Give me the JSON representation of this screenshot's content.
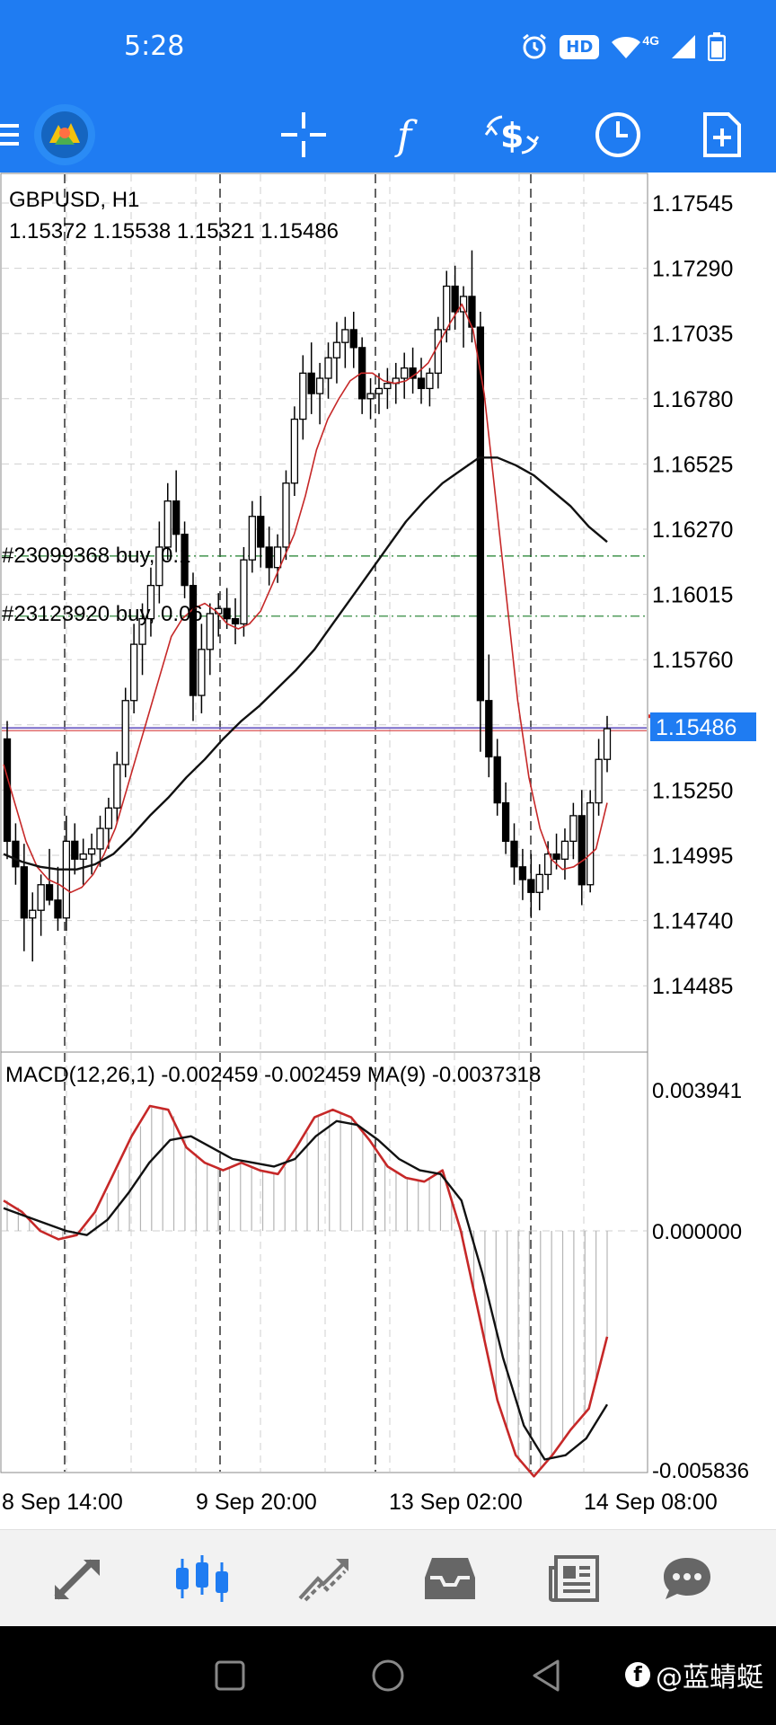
{
  "status_bar": {
    "time": "5:28",
    "hd_label": "HD",
    "network_label": "4G",
    "icons": [
      "alarm-icon",
      "wifi-icon",
      "signal-icon",
      "battery-icon"
    ]
  },
  "toolbar": {
    "buttons": [
      "menu-icon",
      "app-logo",
      "crosshair-icon",
      "function-icon",
      "currency-icon",
      "clock-icon",
      "new-document-icon"
    ]
  },
  "chart": {
    "symbol_label": "GBPUSD, H1",
    "ohlc_label": "1.15372 1.15538 1.15321 1.15486",
    "current_price": "1.15486",
    "price_color": "#1f7cf2",
    "bid_line_color": "#d32f2f",
    "ma_fast_color": "#c62828",
    "ma_slow_color": "#111111",
    "order_lines": [
      {
        "label": "#23099368 buy, 0.1",
        "price": 1.16165
      },
      {
        "label": "#23123920 buy, 0.06",
        "price": 1.1593
      }
    ],
    "price_axis": [
      "1.17545",
      "1.17290",
      "1.17035",
      "1.16780",
      "1.16525",
      "1.16270",
      "1.16015",
      "1.15760",
      "1.15250",
      "1.14995",
      "1.14740",
      "1.14485"
    ],
    "macd_label": "MACD(12,26,1) -0.002459 -0.002459 MA(9) -0.0037318",
    "macd_axis": [
      "0.003941",
      "0.000000",
      "-0.005836"
    ],
    "time_axis": [
      "8 Sep 14:00",
      "9 Sep 20:00",
      "13 Sep 02:00",
      "14 Sep 08:00"
    ]
  },
  "chart_data": {
    "type": "candlestick",
    "title": "GBPUSD, H1",
    "ylim": [
      1.1436,
      1.1766
    ],
    "macd_ylim": [
      -0.005836,
      0.003941
    ],
    "candles": [
      [
        1.1545,
        1.1552,
        1.1498,
        1.1505
      ],
      [
        1.1505,
        1.1512,
        1.1488,
        1.1495
      ],
      [
        1.1495,
        1.1504,
        1.1462,
        1.1475
      ],
      [
        1.1475,
        1.1485,
        1.1458,
        1.1478
      ],
      [
        1.1478,
        1.1492,
        1.1468,
        1.1488
      ],
      [
        1.1488,
        1.1502,
        1.148,
        1.1482
      ],
      [
        1.1482,
        1.1495,
        1.147,
        1.1475
      ],
      [
        1.1475,
        1.1515,
        1.147,
        1.1505
      ],
      [
        1.1505,
        1.1512,
        1.1492,
        1.1498
      ],
      [
        1.1498,
        1.1506,
        1.1488,
        1.15
      ],
      [
        1.15,
        1.1508,
        1.1492,
        1.1502
      ],
      [
        1.1502,
        1.1515,
        1.1495,
        1.151
      ],
      [
        1.151,
        1.1522,
        1.1502,
        1.1518
      ],
      [
        1.1518,
        1.154,
        1.1512,
        1.1535
      ],
      [
        1.1535,
        1.1565,
        1.153,
        1.156
      ],
      [
        1.156,
        1.159,
        1.1555,
        1.1582
      ],
      [
        1.1582,
        1.1598,
        1.157,
        1.1592
      ],
      [
        1.1592,
        1.1612,
        1.1585,
        1.1605
      ],
      [
        1.1605,
        1.163,
        1.1598,
        1.162
      ],
      [
        1.162,
        1.1645,
        1.1615,
        1.1638
      ],
      [
        1.1638,
        1.165,
        1.1618,
        1.1625
      ],
      [
        1.1625,
        1.163,
        1.16,
        1.1605
      ],
      [
        1.1605,
        1.161,
        1.1552,
        1.1562
      ],
      [
        1.1562,
        1.159,
        1.1555,
        1.158
      ],
      [
        1.158,
        1.1598,
        1.157,
        1.1594
      ],
      [
        1.1594,
        1.1602,
        1.1585,
        1.1596
      ],
      [
        1.1596,
        1.1604,
        1.1588,
        1.1592
      ],
      [
        1.1592,
        1.16,
        1.1582,
        1.159
      ],
      [
        1.159,
        1.162,
        1.1585,
        1.1615
      ],
      [
        1.1615,
        1.1638,
        1.161,
        1.1632
      ],
      [
        1.1632,
        1.164,
        1.1612,
        1.162
      ],
      [
        1.162,
        1.1628,
        1.1605,
        1.1612
      ],
      [
        1.1612,
        1.1625,
        1.1606,
        1.162
      ],
      [
        1.162,
        1.165,
        1.1615,
        1.1645
      ],
      [
        1.1645,
        1.1675,
        1.164,
        1.167
      ],
      [
        1.167,
        1.1695,
        1.1662,
        1.1688
      ],
      [
        1.1688,
        1.17,
        1.1672,
        1.168
      ],
      [
        1.168,
        1.1692,
        1.1668,
        1.1686
      ],
      [
        1.1686,
        1.17,
        1.1678,
        1.1694
      ],
      [
        1.1694,
        1.1708,
        1.1684,
        1.17
      ],
      [
        1.17,
        1.171,
        1.169,
        1.1705
      ],
      [
        1.1705,
        1.1712,
        1.169,
        1.1698
      ],
      [
        1.1698,
        1.1702,
        1.1672,
        1.1678
      ],
      [
        1.1678,
        1.1686,
        1.167,
        1.168
      ],
      [
        1.168,
        1.1688,
        1.1672,
        1.1682
      ],
      [
        1.1682,
        1.169,
        1.1674,
        1.1684
      ],
      [
        1.1684,
        1.1692,
        1.1676,
        1.1686
      ],
      [
        1.1686,
        1.1696,
        1.1678,
        1.169
      ],
      [
        1.169,
        1.1698,
        1.168,
        1.1686
      ],
      [
        1.1686,
        1.1694,
        1.1676,
        1.1682
      ],
      [
        1.1682,
        1.169,
        1.1675,
        1.1688
      ],
      [
        1.1688,
        1.171,
        1.1682,
        1.1705
      ],
      [
        1.1705,
        1.1728,
        1.17,
        1.1722
      ],
      [
        1.1722,
        1.173,
        1.1705,
        1.1712
      ],
      [
        1.1712,
        1.1722,
        1.1698,
        1.1718
      ],
      [
        1.1718,
        1.1736,
        1.17,
        1.1706
      ],
      [
        1.1706,
        1.1712,
        1.154,
        1.156
      ],
      [
        1.156,
        1.1578,
        1.153,
        1.1538
      ],
      [
        1.1538,
        1.1545,
        1.1515,
        1.152
      ],
      [
        1.152,
        1.1528,
        1.15,
        1.1505
      ],
      [
        1.1505,
        1.1512,
        1.1488,
        1.1495
      ],
      [
        1.1495,
        1.1502,
        1.1482,
        1.149
      ],
      [
        1.149,
        1.15,
        1.1475,
        1.1485
      ],
      [
        1.1485,
        1.1496,
        1.1478,
        1.1492
      ],
      [
        1.1492,
        1.1505,
        1.1486,
        1.15
      ],
      [
        1.15,
        1.1508,
        1.1494,
        1.1498
      ],
      [
        1.1498,
        1.151,
        1.149,
        1.1505
      ],
      [
        1.1505,
        1.152,
        1.1498,
        1.1515
      ],
      [
        1.1515,
        1.1525,
        1.148,
        1.1488
      ],
      [
        1.1488,
        1.1525,
        1.1485,
        1.152
      ],
      [
        1.152,
        1.1545,
        1.1515,
        1.1537
      ],
      [
        1.1537,
        1.1554,
        1.1532,
        1.1549
      ]
    ],
    "ma_fast": [
      1.1535,
      1.152,
      1.1505,
      1.1495,
      1.149,
      1.1488,
      1.1485,
      1.1487,
      1.1492,
      1.15,
      1.151,
      1.1525,
      1.154,
      1.1555,
      1.157,
      1.1585,
      1.1592,
      1.1596,
      1.1598,
      1.1595,
      1.159,
      1.1588,
      1.159,
      1.1595,
      1.1605,
      1.1615,
      1.1625,
      1.164,
      1.1658,
      1.167,
      1.1678,
      1.1685,
      1.1688,
      1.1688,
      1.1685,
      1.1684,
      1.1685,
      1.1688,
      1.1692,
      1.17,
      1.1708,
      1.1715,
      1.1705,
      1.168,
      1.164,
      1.16,
      1.156,
      1.153,
      1.151,
      1.1498,
      1.1494,
      1.1495,
      1.1498,
      1.1502,
      1.152
    ],
    "ma_slow": [
      1.15,
      1.1497,
      1.1495,
      1.1494,
      1.1494,
      1.1496,
      1.15,
      1.1507,
      1.1515,
      1.1522,
      1.153,
      1.1537,
      1.1545,
      1.1552,
      1.1558,
      1.1565,
      1.1572,
      1.158,
      1.159,
      1.16,
      1.161,
      1.162,
      1.163,
      1.1638,
      1.1645,
      1.165,
      1.1655,
      1.1655,
      1.1652,
      1.1648,
      1.1642,
      1.1636,
      1.1628,
      1.1622
    ],
    "macd_line": [
      0.0008,
      0.0005,
      0.0,
      -0.0002,
      -0.0001,
      0.0005,
      0.0015,
      0.0025,
      0.0033,
      0.0032,
      0.0022,
      0.0018,
      0.0016,
      0.0018,
      0.0016,
      0.0015,
      0.0022,
      0.003,
      0.0032,
      0.003,
      0.0024,
      0.0017,
      0.0014,
      0.0013,
      0.0016,
      0.0,
      -0.002,
      -0.004,
      -0.0053,
      -0.0058,
      -0.0053,
      -0.0047,
      -0.0042,
      -0.0025
    ],
    "macd_signal": [
      0.0006,
      0.0004,
      0.0002,
      0.0,
      -0.0001,
      0.0003,
      0.001,
      0.0018,
      0.0024,
      0.0025,
      0.0022,
      0.0019,
      0.0018,
      0.0017,
      0.0019,
      0.0025,
      0.0029,
      0.0028,
      0.0024,
      0.0019,
      0.0016,
      0.0015,
      0.0008,
      -0.001,
      -0.003,
      -0.0046,
      -0.0054,
      -0.0053,
      -0.0049,
      -0.0041
    ],
    "time_labels": [
      "8 Sep 14:00",
      "9 Sep 20:00",
      "13 Sep 02:00",
      "14 Sep 08:00"
    ]
  },
  "bottom_nav": [
    "quotes-icon",
    "chart-icon",
    "trade-icon",
    "history-icon",
    "news-icon",
    "chat-icon"
  ],
  "watermark": "@蓝蜻蜓"
}
